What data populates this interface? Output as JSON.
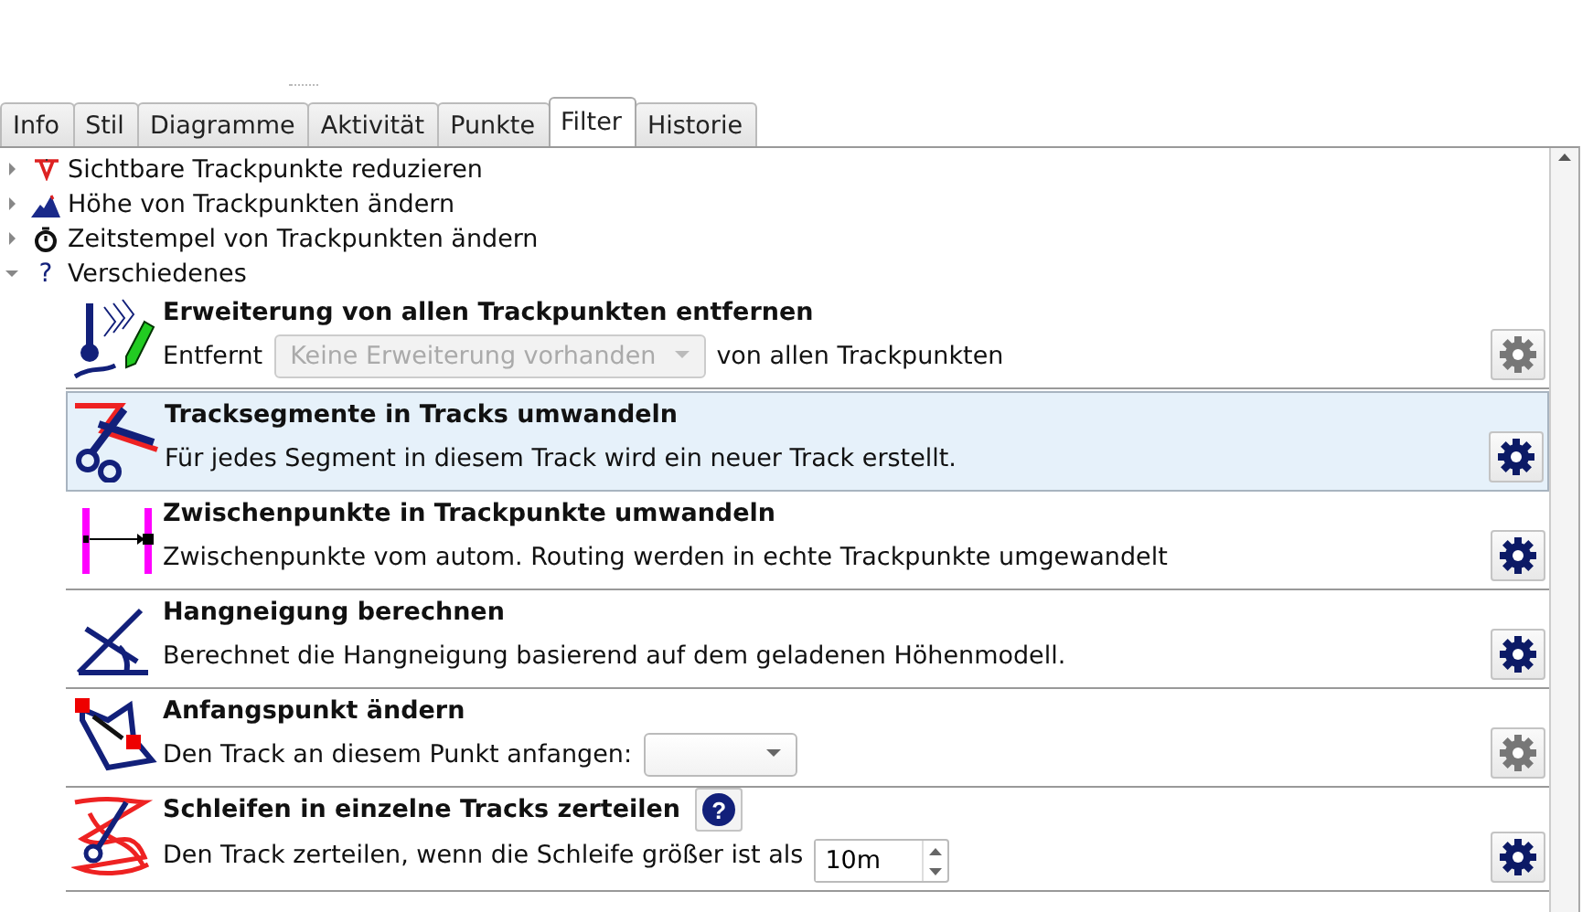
{
  "tabs": [
    {
      "label": "Info",
      "selected": false
    },
    {
      "label": "Stil",
      "selected": false
    },
    {
      "label": "Diagramme",
      "selected": false
    },
    {
      "label": "Aktivität",
      "selected": false
    },
    {
      "label": "Punkte",
      "selected": false
    },
    {
      "label": "Filter",
      "selected": true
    },
    {
      "label": "Historie",
      "selected": false
    }
  ],
  "tree": [
    {
      "label": "Sichtbare Trackpunkte reduzieren",
      "expanded": false
    },
    {
      "label": "Höhe von Trackpunkten ändern",
      "expanded": false
    },
    {
      "label": "Zeitstempel von Trackpunkten ändern",
      "expanded": false
    },
    {
      "label": "Verschiedenes",
      "expanded": true,
      "glyph": "?"
    }
  ],
  "filters": [
    {
      "title": "Erweiterung von allen Trackpunkten entfernen",
      "selected": false,
      "settings_enabled": false,
      "parts": [
        {
          "kind": "text",
          "text": "Entfernt"
        },
        {
          "kind": "combo",
          "value": "Keine Erweiterung vorhanden",
          "disabled": true
        },
        {
          "kind": "text",
          "text": "von allen Trackpunkten"
        }
      ]
    },
    {
      "title": "Tracksegmente in Tracks umwandeln",
      "selected": true,
      "settings_enabled": true,
      "parts": [
        {
          "kind": "text",
          "text": "Für jedes Segment in diesem Track wird ein neuer Track erstellt."
        }
      ]
    },
    {
      "title": "Zwischenpunkte in Trackpunkte umwandeln",
      "selected": false,
      "settings_enabled": true,
      "parts": [
        {
          "kind": "text",
          "text": "Zwischenpunkte vom autom. Routing werden in echte Trackpunkte umgewandelt"
        }
      ]
    },
    {
      "title": "Hangneigung berechnen",
      "selected": false,
      "settings_enabled": true,
      "parts": [
        {
          "kind": "text",
          "text": "Berechnet die Hangneigung basierend auf dem geladenen Höhenmodell."
        }
      ]
    },
    {
      "title": "Anfangspunkt ändern",
      "selected": false,
      "settings_enabled": false,
      "parts": [
        {
          "kind": "text",
          "text": "Den Track an diesem Punkt anfangen:"
        },
        {
          "kind": "combo",
          "disabled": false
        }
      ]
    },
    {
      "title": "Schleifen in einzelne Tracks zerteilen",
      "help": "?",
      "selected": false,
      "settings_enabled": true,
      "parts": [
        {
          "kind": "text",
          "text": "Den Track zerteilen, wenn die Schleife größer ist als"
        },
        {
          "kind": "spin",
          "value": "10m"
        }
      ]
    }
  ]
}
